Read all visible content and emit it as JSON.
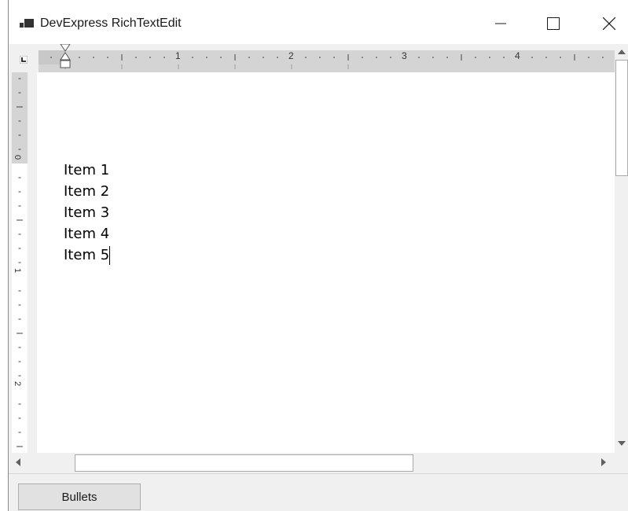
{
  "window": {
    "title": "DevExpress RichTextEdit",
    "icon": "app-window-icon",
    "controls": [
      "minimize-icon",
      "maximize-icon",
      "close-icon"
    ]
  },
  "ruler": {
    "horizontal_labels": [
      "1",
      "2",
      "3",
      "4"
    ],
    "vertical_labels": [
      "0",
      "1",
      "2"
    ],
    "tab_selector_icon": "tab-stop-left-icon"
  },
  "document": {
    "paragraphs": [
      "Item 1",
      "Item 2",
      "Item 3",
      "Item 4",
      "Item 5"
    ]
  },
  "scrollbars": {
    "up_icon": "scroll-up-arrow-icon",
    "down_icon": "scroll-down-arrow-icon",
    "left_icon": "scroll-left-arrow-icon",
    "right_icon": "scroll-right-arrow-icon"
  },
  "panel": {
    "bullets_button_label": "Bullets"
  },
  "colors": {
    "ruler_track": "#d4d4d4",
    "chrome_background": "#f0f0f0",
    "document_background": "#ffffff"
  }
}
